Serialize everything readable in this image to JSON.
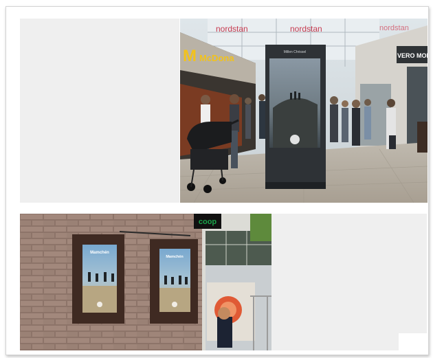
{
  "photos": {
    "mall": {
      "sign_mcdonalds": "McDona",
      "sign_nordstan_1": "nordstan",
      "sign_nordstan_2": "nordstan",
      "sign_nordstan_3": "nordstan",
      "sign_veromoda": "VERO MOD",
      "kiosk_header": "Millen Chrissel",
      "kiosk_footer_left": "",
      "kiosk_footer_right": ""
    },
    "street": {
      "sign_coop": "coop",
      "screen_left_title": "Mamchén",
      "screen_right_title": "Mamchén"
    }
  },
  "colors": {
    "mcdonalds_yellow": "#f2c21b",
    "coop_green": "#1aa34a",
    "frame_border": "#d4d4d4",
    "placeholder_gray": "#efefef"
  }
}
